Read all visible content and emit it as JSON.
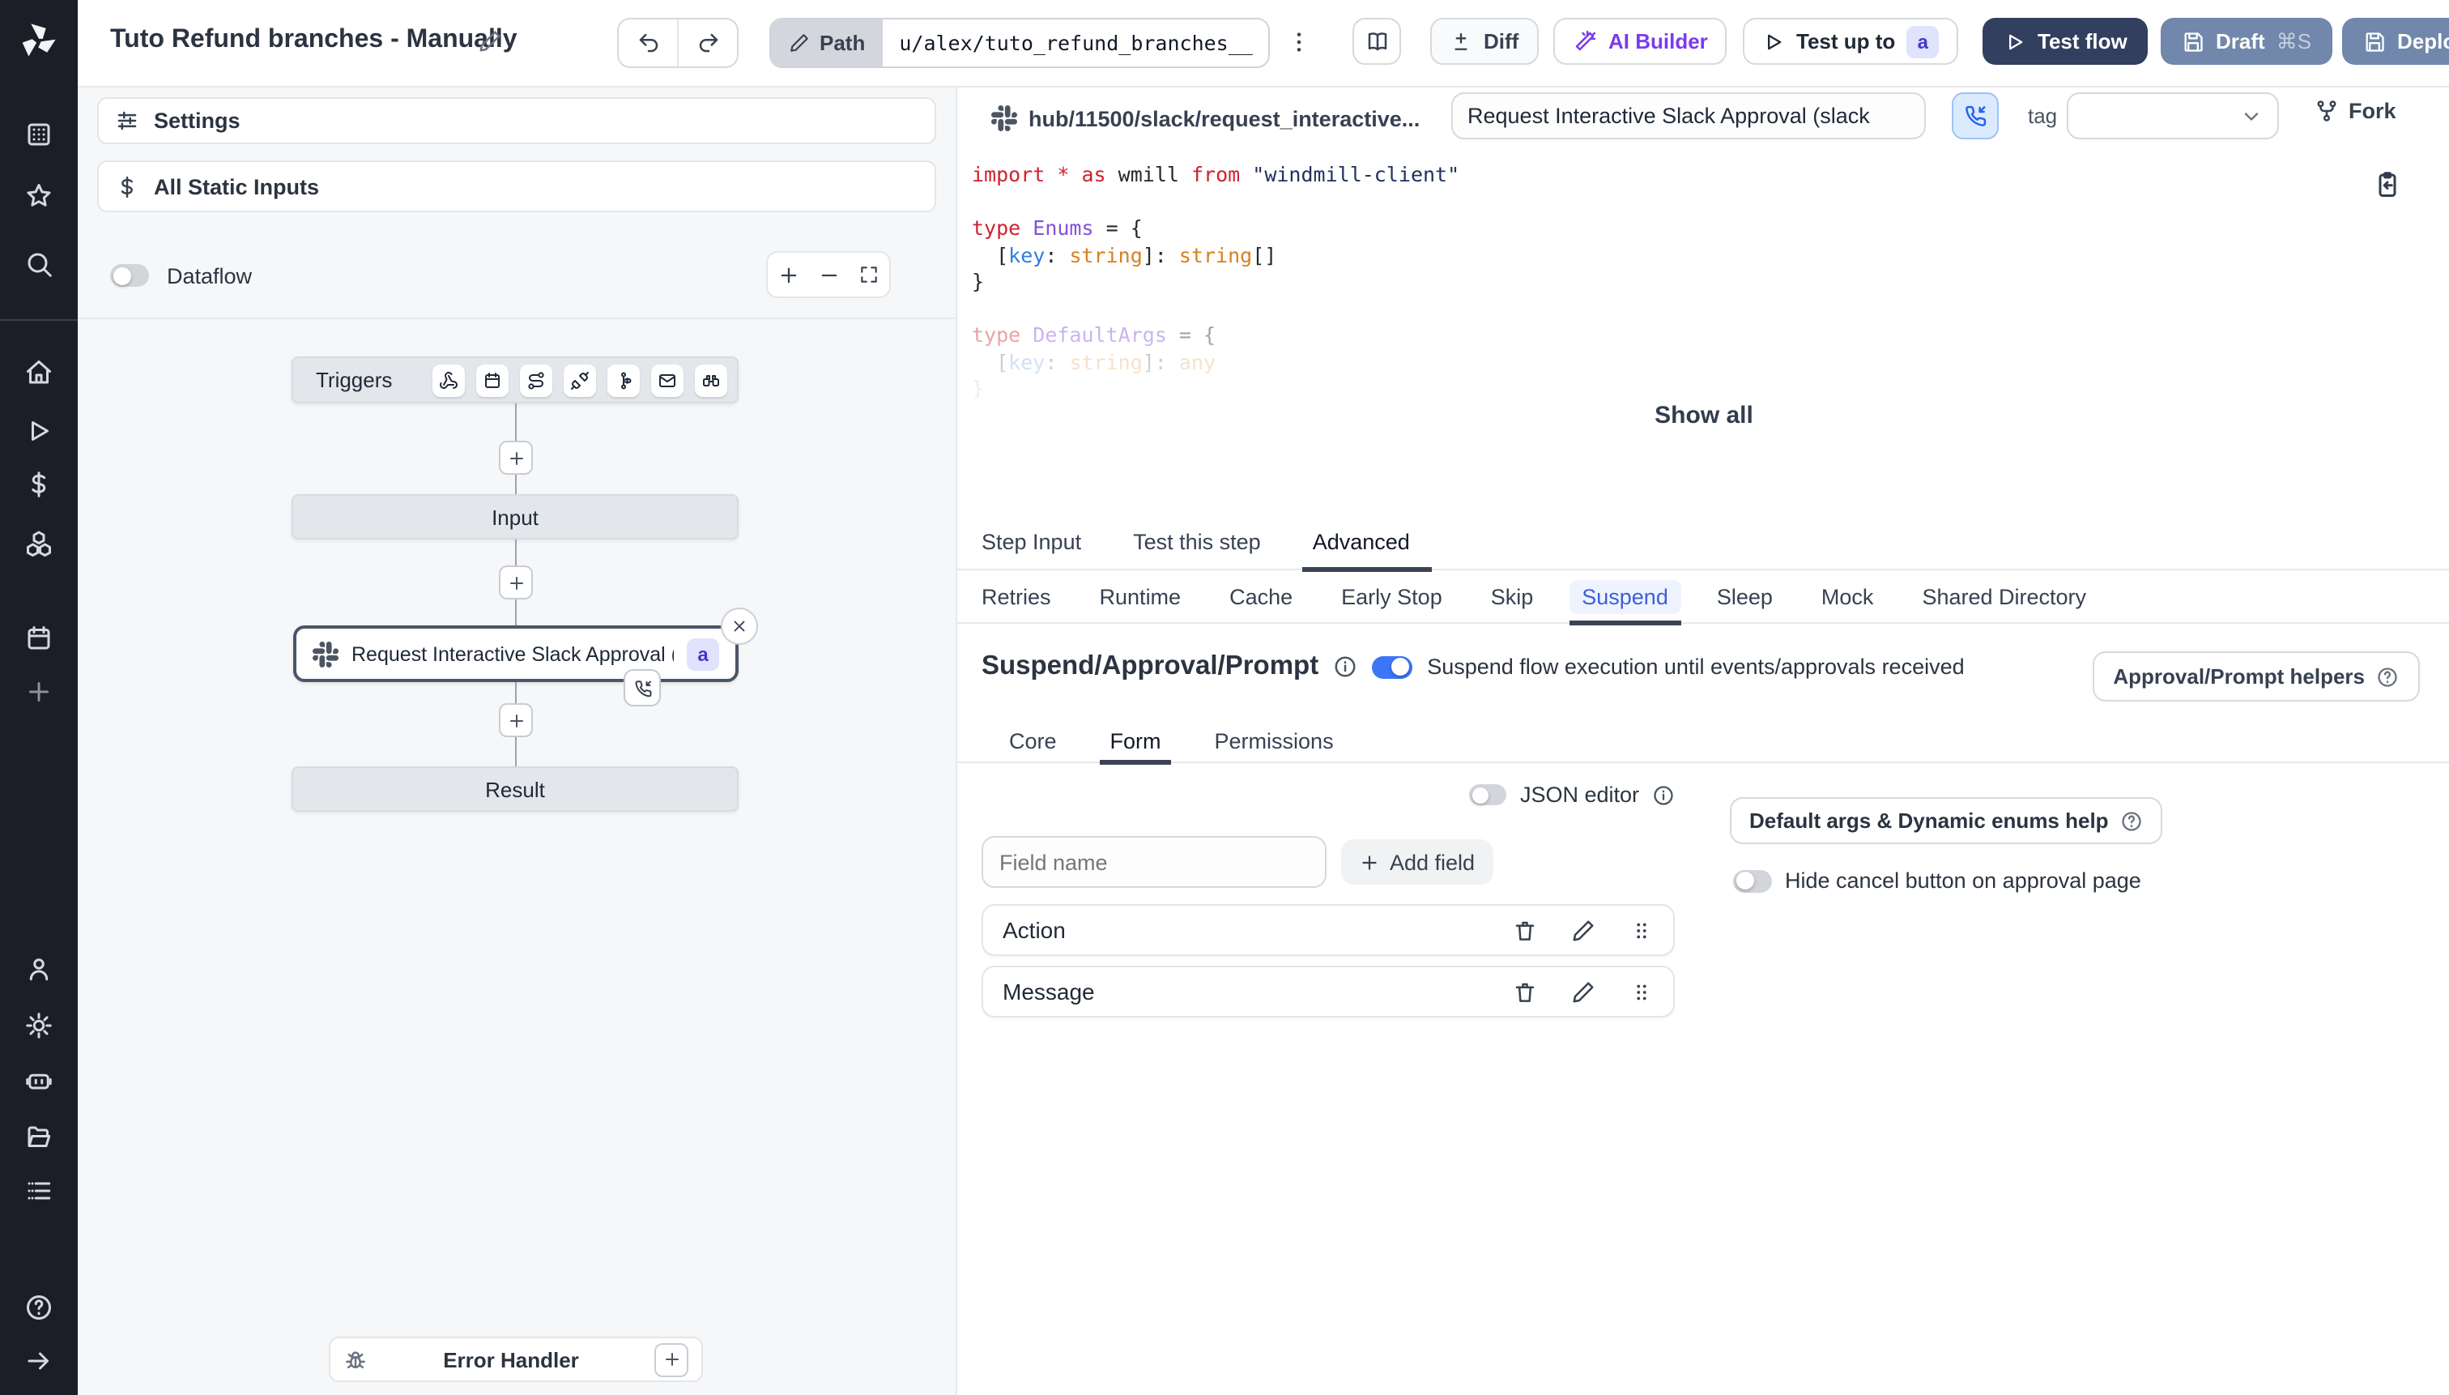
{
  "topbar": {
    "title": "Tuto Refund branches - Manually",
    "path_label": "Path",
    "path_value": "u/alex/tuto_refund_branches__",
    "diff": "Diff",
    "ai_builder": "AI Builder",
    "test_up_to": "Test up to",
    "test_up_to_badge": "a",
    "test_flow": "Test flow",
    "draft": "Draft",
    "draft_shortcut": "⌘S",
    "deploy": "Deploy"
  },
  "left_panel": {
    "settings": "Settings",
    "all_static_inputs": "All Static Inputs",
    "dataflow": "Dataflow"
  },
  "graph": {
    "triggers_label": "Triggers",
    "trigger_icons": [
      "webhook",
      "schedule",
      "route",
      "websocket",
      "kafka",
      "email",
      "poll"
    ],
    "input_label": "Input",
    "step_label": "Request Interactive Slack Approval (...",
    "step_badge": "a",
    "result_label": "Result",
    "error_handler": "Error Handler"
  },
  "step_header": {
    "hub_path": "hub/11500/slack/request_interactive...",
    "name_value": "Request Interactive Slack Approval (slack",
    "tag_label": "tag",
    "fork": "Fork"
  },
  "code": {
    "show_all": "Show all",
    "lines": [
      {
        "fade": "",
        "tokens": [
          [
            "kw",
            "import"
          ],
          [
            "pl",
            " "
          ],
          [
            "kw",
            "*"
          ],
          [
            "pl",
            " "
          ],
          [
            "kw",
            "as"
          ],
          [
            "pl",
            " wmill "
          ],
          [
            "kw",
            "from"
          ],
          [
            "pl",
            " "
          ],
          [
            "str",
            "\"windmill-client\""
          ]
        ]
      },
      {
        "fade": "",
        "tokens": []
      },
      {
        "fade": "",
        "tokens": [
          [
            "kw",
            "type"
          ],
          [
            "pl",
            " "
          ],
          [
            "tp",
            "Enums"
          ],
          [
            "pl",
            " = {"
          ]
        ]
      },
      {
        "fade": "",
        "tokens": [
          [
            "pl",
            "  ["
          ],
          [
            "vr",
            "key"
          ],
          [
            "pl",
            ": "
          ],
          [
            "or",
            "string"
          ],
          [
            "pl",
            "]: "
          ],
          [
            "or",
            "string"
          ],
          [
            "pl",
            "[]"
          ]
        ]
      },
      {
        "fade": "",
        "tokens": [
          [
            "pl",
            "}"
          ]
        ]
      },
      {
        "fade": "",
        "tokens": []
      },
      {
        "fade": "f1",
        "tokens": [
          [
            "kw",
            "type"
          ],
          [
            "pl",
            " "
          ],
          [
            "tp",
            "DefaultArgs"
          ],
          [
            "pl",
            " = {"
          ]
        ]
      },
      {
        "fade": "f2",
        "tokens": [
          [
            "pl",
            "  ["
          ],
          [
            "vr",
            "key"
          ],
          [
            "pl",
            ": "
          ],
          [
            "or",
            "string"
          ],
          [
            "pl",
            "]: "
          ],
          [
            "or",
            "any"
          ]
        ]
      },
      {
        "fade": "f3",
        "tokens": [
          [
            "pl",
            "}"
          ]
        ]
      }
    ]
  },
  "tabs": {
    "main": [
      "Step Input",
      "Test this step",
      "Advanced"
    ],
    "main_active": "Advanced",
    "advanced": [
      "Retries",
      "Runtime",
      "Cache",
      "Early Stop",
      "Skip",
      "Suspend",
      "Sleep",
      "Mock",
      "Shared Directory"
    ],
    "advanced_active": "Suspend"
  },
  "suspend": {
    "heading": "Suspend/Approval/Prompt",
    "toggle_on": true,
    "toggle_text": "Suspend flow execution until events/approvals received",
    "helpers_button": "Approval/Prompt helpers",
    "tabs": [
      "Core",
      "Form",
      "Permissions"
    ],
    "tabs_active": "Form",
    "json_editor_label": "JSON editor",
    "field_placeholder": "Field name",
    "add_field": "Add field",
    "default_args_help": "Default args & Dynamic enums help",
    "hide_cancel": "Hide cancel button on approval page",
    "fields": [
      "Action",
      "Message"
    ]
  },
  "sidebar_icons": [
    "workspace",
    "favorites",
    "search",
    "home",
    "runs",
    "variables",
    "resources",
    "schedules",
    "add",
    "user",
    "settings",
    "workers",
    "folders",
    "logs",
    "help",
    "expand"
  ],
  "colors": {
    "sidebar_bg": "#1b1e27",
    "primary_toggle": "#3b76f6",
    "test_flow_bg": "#333f5e",
    "draft_deploy_bg": "#7187ab",
    "ai_builder": "#7c3aed",
    "suspend_tab": "#3f5ed7",
    "badge_bg": "#dfe3fb",
    "badge_text": "#4338ca",
    "node_gray": "#e3e6ea",
    "phone_btn_bg": "#dbeafe"
  }
}
